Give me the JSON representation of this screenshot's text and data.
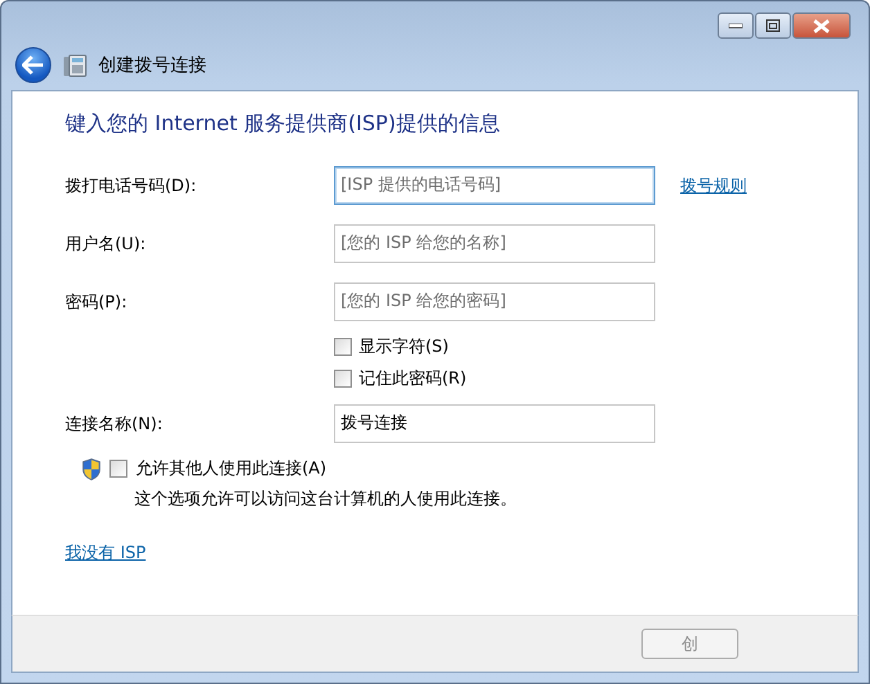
{
  "window": {
    "title": "创建拨号连接"
  },
  "heading": "键入您的 Internet 服务提供商(ISP)提供的信息",
  "fields": [
    {
      "label": "拨打电话号码(D):",
      "placeholder": "[ISP 提供的电话号码]",
      "focused": true,
      "link": "拨号规则"
    },
    {
      "label": "用户名(U):",
      "placeholder": "[您的 ISP 给您的名称]",
      "focused": false
    },
    {
      "label": "密码(P):",
      "placeholder": "[您的 ISP 给您的密码]",
      "focused": false
    }
  ],
  "password_options": [
    {
      "label": "显示字符(S)",
      "checked": false
    },
    {
      "label": "记住此密码(R)",
      "checked": false
    }
  ],
  "connection_name": {
    "label": "连接名称(N):",
    "value": "拨号连接",
    "focused": false
  },
  "allow_others": {
    "label": "允许其他人使用此连接(A)",
    "checked": false,
    "description": "这个选项允许可以访问这台计算机的人使用此连接。"
  },
  "no_isp_link": "我没有 ISP",
  "buttons": [
    {
      "label": "创",
      "disabled": true
    }
  ]
}
